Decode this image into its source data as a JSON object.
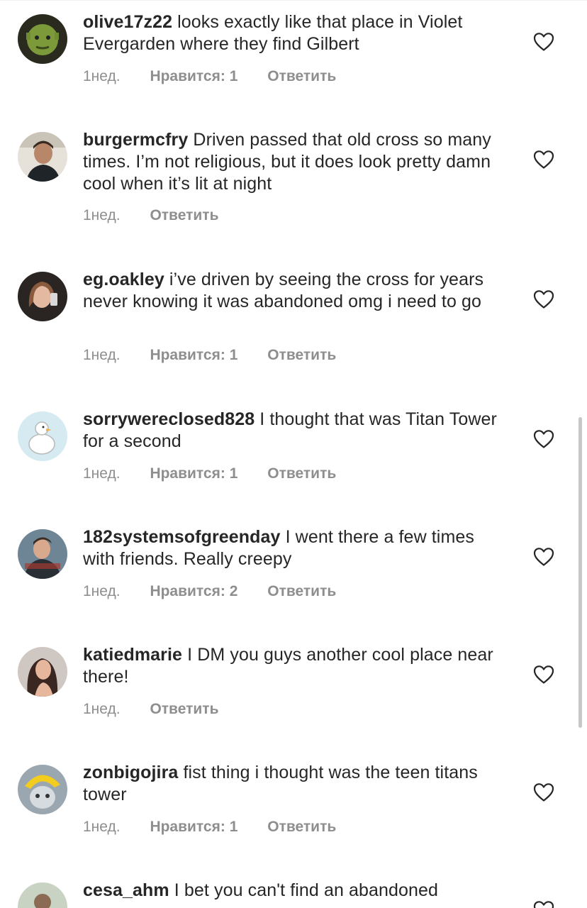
{
  "comments": [
    {
      "username": "olive17z22",
      "text": "looks exactly like that place in Violet Evergarden where they find Gilbert",
      "time": "1нед.",
      "likes": "Нравится: 1",
      "reply": "Ответить"
    },
    {
      "username": "burgermcfry",
      "text": "Driven passed that old cross so many times. I’m not religious, but it does look pretty damn cool when it’s lit at night",
      "time": "1нед.",
      "likes": "",
      "reply": "Ответить"
    },
    {
      "username": "eg.oakley",
      "text": "i’ve driven by seeing the cross for years never knowing it was abandoned omg i need to go",
      "time": "1нед.",
      "likes": "Нравится: 1",
      "reply": "Ответить"
    },
    {
      "username": "sorrywereclosed828",
      "text": "I thought that was Titan Tower for a second",
      "time": "1нед.",
      "likes": "Нравится: 1",
      "reply": "Ответить"
    },
    {
      "username": "182systemsofgreenday",
      "text": "I went there a few times with friends. Really creepy",
      "time": "1нед.",
      "likes": "Нравится: 2",
      "reply": "Ответить"
    },
    {
      "username": "katiedmarie",
      "text": "I DM you guys another cool place near there!",
      "time": "1нед.",
      "likes": "",
      "reply": "Ответить"
    },
    {
      "username": "zonbigojira",
      "text": "fist thing i thought was the teen titans tower",
      "time": "1нед.",
      "likes": "Нравится: 1",
      "reply": "Ответить"
    },
    {
      "username": "cesa_ahm",
      "text": "I bet you can't find an abandoned",
      "time": "",
      "likes": "",
      "reply": ""
    }
  ],
  "icons": {
    "like": "heart-outline-icon",
    "avatar": "user-avatar"
  },
  "colors": {
    "text": "#262626",
    "meta": "#8e8e8e",
    "scrollbar": "#c7c7c7"
  }
}
